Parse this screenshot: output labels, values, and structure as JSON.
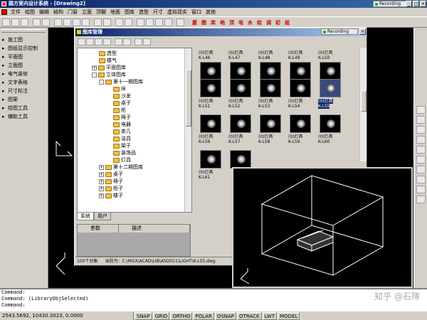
{
  "app": {
    "title": "圆方室内设计系统 - [Drawing2]",
    "recording": "Recording"
  },
  "menu": [
    "文件",
    "绘图",
    "编辑",
    "结构",
    "门窗",
    "立面",
    "顶棚",
    "地面",
    "图库",
    "造型",
    "尺寸",
    "虚拟现实",
    "窗口",
    "其他"
  ],
  "toolbar": {
    "red_items": [
      "屋",
      "图",
      "库",
      "地",
      "顶",
      "电",
      "水",
      "绘",
      "调",
      "初",
      "组"
    ]
  },
  "left_panel": {
    "items": [
      "施工图",
      "图纸显示控制",
      "平面图",
      "立面图",
      "电气装修",
      "文字表格",
      "尺寸标注",
      "图案",
      "绘图工具",
      "辅助工具"
    ]
  },
  "dialog": {
    "title": "图库管理",
    "recording": "Recording",
    "tree": [
      {
        "label": "造型",
        "indent": 3,
        "pm": ""
      },
      {
        "label": "楼气",
        "indent": 3,
        "pm": ""
      },
      {
        "label": "平面图库",
        "indent": 2,
        "pm": "+"
      },
      {
        "label": "立体图库",
        "indent": 2,
        "pm": "-"
      },
      {
        "label": "第十一期图库",
        "indent": 3,
        "pm": "-"
      },
      {
        "label": "床",
        "indent": 4,
        "pm": ""
      },
      {
        "label": "沙发",
        "indent": 4,
        "pm": ""
      },
      {
        "label": "桌子",
        "indent": 4,
        "pm": ""
      },
      {
        "label": "柜",
        "indent": 4,
        "pm": ""
      },
      {
        "label": "椅子",
        "indent": 4,
        "pm": ""
      },
      {
        "label": "电器",
        "indent": 4,
        "pm": ""
      },
      {
        "label": "茶几",
        "indent": 4,
        "pm": ""
      },
      {
        "label": "洁具",
        "indent": 4,
        "pm": ""
      },
      {
        "label": "架子",
        "indent": 4,
        "pm": ""
      },
      {
        "label": "装饰品",
        "indent": 4,
        "pm": ""
      },
      {
        "label": "灯具",
        "indent": 4,
        "pm": ""
      },
      {
        "label": "第十二期图库",
        "indent": 3,
        "pm": "+"
      },
      {
        "label": "桌子",
        "indent": 3,
        "pm": "+"
      },
      {
        "label": "椅子",
        "indent": 3,
        "pm": "+"
      },
      {
        "label": "柜子",
        "indent": 3,
        "pm": "+"
      },
      {
        "label": "楼子",
        "indent": 3,
        "pm": "+"
      }
    ],
    "tabs": [
      "系统",
      "用户"
    ],
    "props_headers": [
      "参数",
      "描述"
    ],
    "grid": [
      {
        "lab1": "(0)灯具",
        "lab2": "K-L46"
      },
      {
        "lab1": "(0)灯具",
        "lab2": "K-L47"
      },
      {
        "lab1": "(0)灯具",
        "lab2": "K-L48"
      },
      {
        "lab1": "(0)灯具",
        "lab2": "K-L49"
      },
      {
        "lab1": "(0)灯具",
        "lab2": "K-L50"
      },
      {
        "lab1": "(0)灯具",
        "lab2": "K-L51"
      },
      {
        "lab1": "(0)灯具",
        "lab2": "K-L52"
      },
      {
        "lab1": "(0)灯具",
        "lab2": "K-L53"
      },
      {
        "lab1": "(0)灯具",
        "lab2": "K-L54"
      },
      {
        "lab1": "(0)灯具",
        "lab2": "K-L55",
        "selected": true
      },
      {
        "lab1": "(0)灯具",
        "lab2": "K-L56"
      },
      {
        "lab1": "(0)灯具",
        "lab2": "K-L57"
      },
      {
        "lab1": "(0)灯具",
        "lab2": "K-L58"
      },
      {
        "lab1": "(0)灯具",
        "lab2": "K-L59"
      },
      {
        "lab1": "(0)灯具",
        "lab2": "K-L60"
      },
      {
        "lab1": "(0)灯具",
        "lab2": "K-L61"
      }
    ],
    "status_count": "100个对象",
    "status_path": "当前为：C:\\MGX\\ACAD\\LIB\\ASD011\\LIGHT\\K-L55.dwg"
  },
  "command": {
    "line1": "Command:",
    "line2": "Command: (LibraryObjSelected)",
    "line3": "Command:"
  },
  "status": {
    "coords": "2543.5692, 10430.3023, 0.0000",
    "toggles": [
      "SNAP",
      "GRID",
      "ORTHO",
      "POLAR",
      "OSNAP",
      "OTRACK",
      "LWT",
      "MODEL"
    ]
  },
  "watermark": "知乎 @石隊"
}
